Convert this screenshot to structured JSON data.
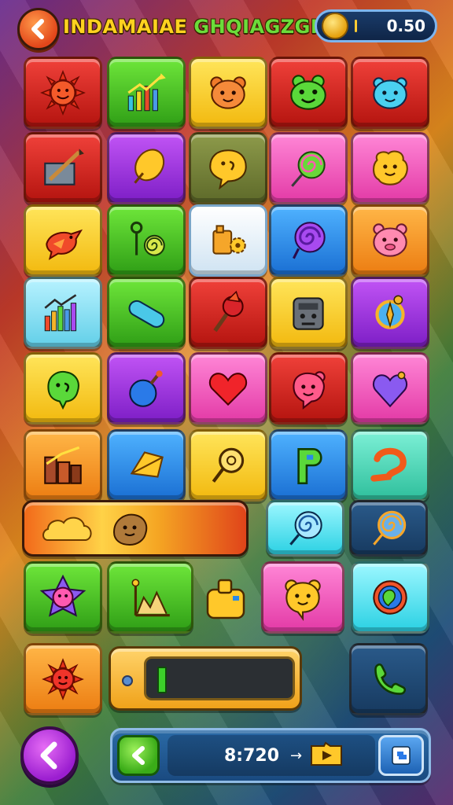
{
  "header": {
    "title_word1": "INDAMAIAE",
    "title_word2": "GHQIAGZGH!",
    "coins": "0.50"
  },
  "tiles": [
    {
      "icon": "sun-face-icon",
      "color": "#d8241a"
    },
    {
      "icon": "growth-chart-icon",
      "color": "#45c522"
    },
    {
      "icon": "bear-face-icon",
      "color": "#f7cf27"
    },
    {
      "icon": "frog-face-icon",
      "color": "#d8241a"
    },
    {
      "icon": "blue-blob-face-icon",
      "color": "#d8241a"
    },
    {
      "icon": "pen-box-icon",
      "color": "#d8241a"
    },
    {
      "icon": "leaf-icon",
      "color": "#a233e0"
    },
    {
      "icon": "speech-smiley-icon",
      "color": "#778540"
    },
    {
      "icon": "lollipop-icon",
      "color": "#e33aa6"
    },
    {
      "icon": "yellow-blob-face-icon",
      "color": "#e33aa6"
    },
    {
      "icon": "bird-icon",
      "color": "#f7cf27"
    },
    {
      "icon": "key-spiral-icon",
      "color": "#45c522"
    },
    {
      "icon": "gear-box-icon",
      "color": "#ffffff"
    },
    {
      "icon": "purple-swirl-icon",
      "color": "#2a89e8"
    },
    {
      "icon": "pig-face-icon",
      "color": "#f39a2a"
    },
    {
      "icon": "bar-chart-icon",
      "color": "#8ee2f3"
    },
    {
      "icon": "pill-capsule-icon",
      "color": "#45c522"
    },
    {
      "icon": "torch-icon",
      "color": "#d8241a"
    },
    {
      "icon": "robot-box-icon",
      "color": "#f7cf27"
    },
    {
      "icon": "compass-icon",
      "color": "#a233e0"
    },
    {
      "icon": "green-monster-icon",
      "color": "#f7cf27"
    },
    {
      "icon": "bomb-icon",
      "color": "#a233e0"
    },
    {
      "icon": "heart-icon",
      "color": "#e33aa6"
    },
    {
      "icon": "red-monster-icon",
      "color": "#d8241a"
    },
    {
      "icon": "heart-pin-icon",
      "color": "#e33aa6"
    },
    {
      "icon": "chart-building-icon",
      "color": "#f39a2a"
    },
    {
      "icon": "diamond-leaf-icon",
      "color": "#2a89e8"
    },
    {
      "icon": "magnifier-icon",
      "color": "#f7cf27"
    },
    {
      "icon": "letter-p-icon",
      "color": "#2a89e8"
    },
    {
      "icon": "hook-icon",
      "color": "#55d8b8"
    },
    {
      "icon": "blue-swirl-icon",
      "color": "#62cfe8"
    },
    {
      "icon": "orange-swirl-icon",
      "color": "#173a60"
    },
    {
      "icon": "star-blob-icon",
      "color": "#45c522"
    },
    {
      "icon": "mountain-chart-icon",
      "color": "#45c522"
    },
    {
      "icon": "yellow-bear-icon",
      "color": "#e33aa6"
    },
    {
      "icon": "globe-icon",
      "color": "#2bd1e3"
    },
    {
      "icon": "sun-small-icon",
      "color": "#f39a2a"
    },
    {
      "icon": "phone-icon",
      "color": "#173a60"
    }
  ],
  "wide_bar": {
    "icons": [
      "cloud-icon",
      "seal-face-icon"
    ]
  },
  "progress": {
    "fill_fraction": 0.05
  },
  "bottom": {
    "score": "8:720",
    "arrow": "→"
  }
}
